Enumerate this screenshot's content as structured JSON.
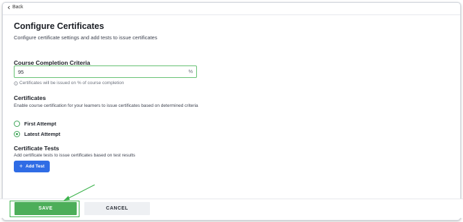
{
  "nav": {
    "back_label": "Back"
  },
  "page": {
    "title": "Configure Certificates",
    "subtitle": "Configure certificate settings and add tests to issue certificates"
  },
  "completion": {
    "label": "Course Completion Criteria",
    "value": "95",
    "unit": "%",
    "hint": "Certificates will be issued on % of course completion"
  },
  "certificates": {
    "label": "Certificates",
    "description": "Enable course certification for your learners to issue certificates based on determined criteria",
    "options": [
      {
        "label": "First Attempt",
        "selected": false
      },
      {
        "label": "Latest Attempt",
        "selected": true
      }
    ]
  },
  "tests": {
    "label": "Certificate Tests",
    "description": "Add certificate tests to issue certificates based on test results",
    "add_button_label": "Add Test"
  },
  "footer": {
    "save_label": "SAVE",
    "cancel_label": "CANCEL"
  },
  "colors": {
    "accent_green": "#4cae59",
    "primary_blue": "#2f6ce5",
    "annotation_green": "#3ab24a"
  }
}
